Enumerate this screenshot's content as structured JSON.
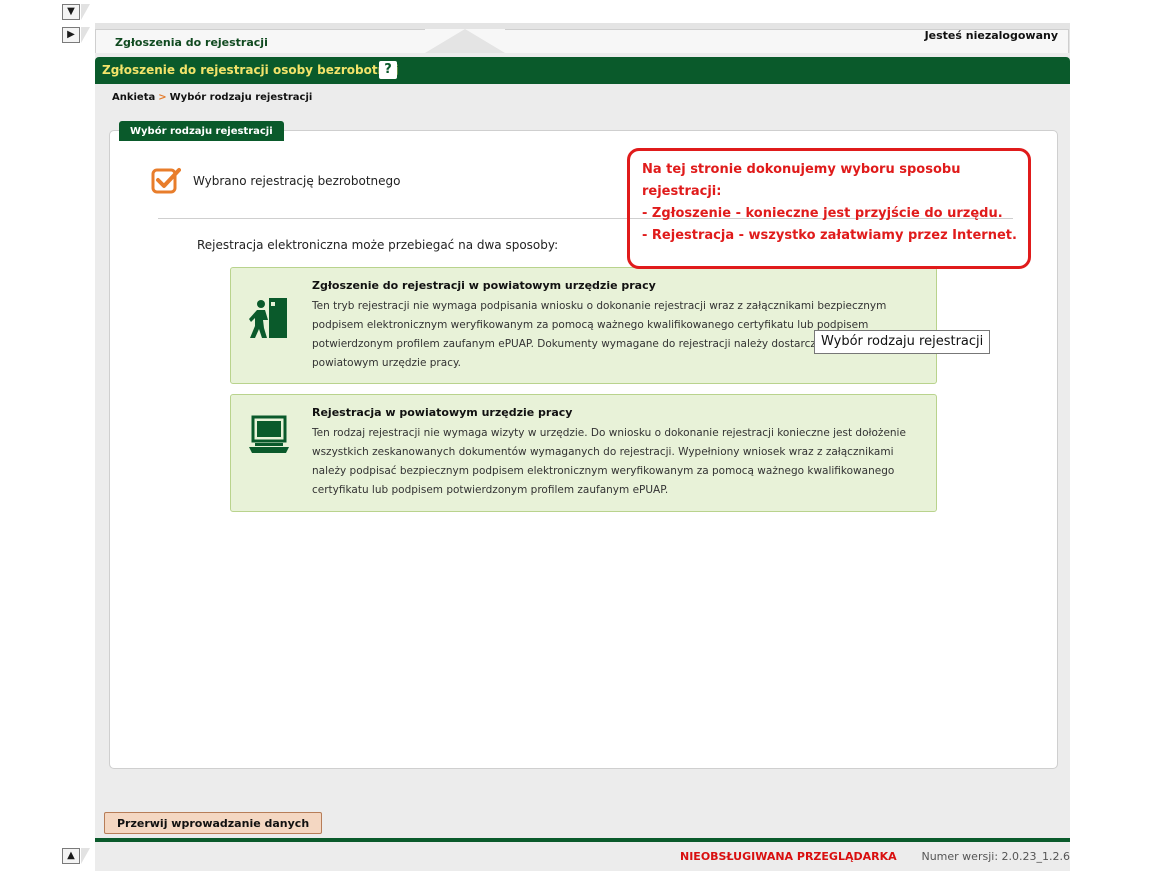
{
  "header": {
    "tab_label": "Zgłoszenia do rejestracji",
    "user_status": "Jesteś niezalogowany"
  },
  "titlebar": {
    "title": "Zgłoszenie do rejestracji osoby bezrobotnej",
    "help_label": "?"
  },
  "breadcrumb": {
    "items": [
      "Ankieta",
      "Wybór rodzaju rejestracji"
    ],
    "separator": ">"
  },
  "panel": {
    "tab_label": "Wybór rodzaju rejestracji",
    "selected_text": "Wybrano rejestrację bezrobotnego",
    "intro": "Rejestracja elektroniczna może przebiegać na dwa sposoby:",
    "options": [
      {
        "title": "Zgłoszenie do rejestracji w powiatowym urzędzie pracy",
        "description": "Ten tryb rejestracji nie wymaga podpisania wniosku o dokonanie rejestracji wraz z załącznikami bezpiecznym podpisem elektronicznym weryfikowanym za pomocą ważnego kwalifikowanego certyfikatu lub podpisem potwierdzonym profilem zaufanym ePUAP. Dokumenty wymagane do rejestracji należy dostarczyć podczas wizyty w powiatowym urzędzie pracy.",
        "icon": "exit-person-icon"
      },
      {
        "title": "Rejestracja w powiatowym urzędzie pracy",
        "description": "Ten rodzaj rejestracji nie wymaga wizyty w urzędzie. Do wniosku o dokonanie rejestracji konieczne jest dołożenie wszystkich zeskanowanych dokumentów wymaganych do rejestracji. Wypełniony wniosek wraz z załącznikami należy podpisać bezpiecznym podpisem elektronicznym weryfikowanym za pomocą ważnego kwalifikowanego certyfikatu lub podpisem potwierdzonym profilem zaufanym ePUAP.",
        "icon": "laptop-icon"
      }
    ]
  },
  "callout": {
    "lines": [
      "Na tej stronie dokonujemy wyboru sposobu",
      "rejestracji:",
      "- Zgłoszenie - konieczne jest przyjście do urzędu.",
      "- Rejestracja - wszystko załatwiamy przez Internet."
    ]
  },
  "tooltip": {
    "text": "Wybór rodzaju rejestracji"
  },
  "actions": {
    "abort_label": "Przerwij wprowadzanie danych"
  },
  "footer": {
    "warning": "NIEOBSŁUGIWANA PRZEGLĄDARKA",
    "version": "Numer wersji: 2.0.23_1.2.6"
  },
  "colors": {
    "brand_green": "#0a5a2b",
    "title_yellow": "#f2e36a",
    "option_bg": "#e8f2d8",
    "callout_red": "#e01b1b",
    "check_orange": "#e87d2b"
  }
}
